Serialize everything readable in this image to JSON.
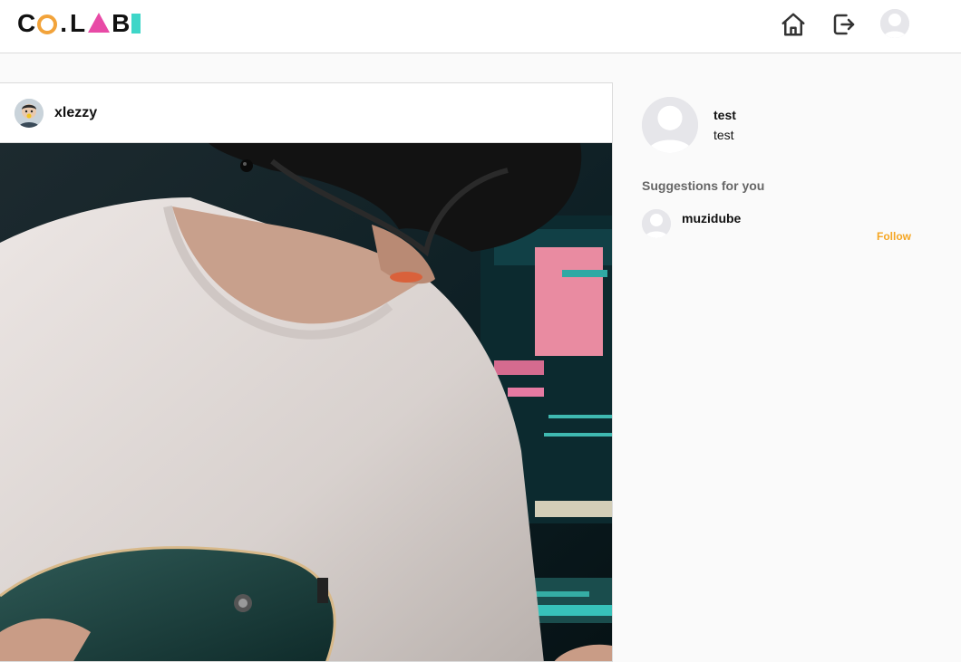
{
  "header": {
    "logo": {
      "c": "C",
      "dot": ".",
      "l": "L",
      "b": "B"
    },
    "icons": [
      "home-icon",
      "logout-icon",
      "profile-avatar"
    ]
  },
  "post": {
    "username": "xlezzy",
    "image_alt": "Musician in white t-shirt playing electric guitar in front of monitor"
  },
  "sidebar": {
    "me": {
      "username": "test",
      "fullname": "test"
    },
    "suggestions_title": "Suggestions for you",
    "suggestions": [
      {
        "username": "muzidube",
        "follow_label": "Follow"
      }
    ]
  },
  "colors": {
    "accent_orange": "#f5a623",
    "logo_pink": "#e84aa6",
    "logo_teal": "#3ed6c8",
    "logo_orange": "#f2a33a"
  }
}
